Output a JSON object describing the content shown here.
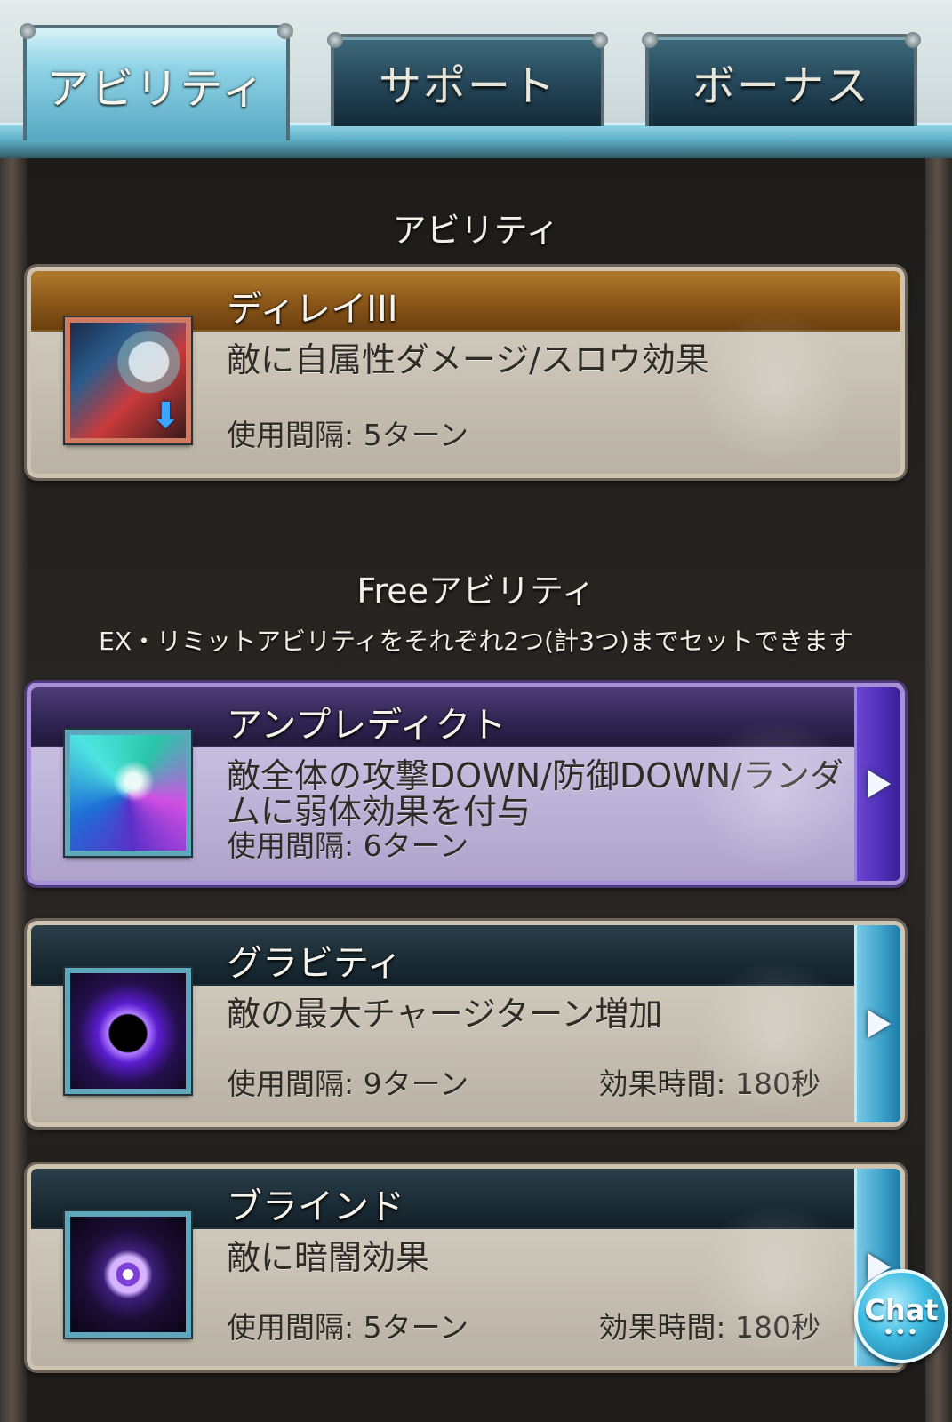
{
  "tabs": [
    {
      "label": "アビリティ",
      "active": true
    },
    {
      "label": "サポート",
      "active": false
    },
    {
      "label": "ボーナス",
      "active": false
    }
  ],
  "ability_section": {
    "title": "アビリティ",
    "items": [
      {
        "name": "ディレイIII",
        "description": "敵に自属性ダメージ/スロウ効果",
        "interval": "使用間隔: 5ターン",
        "icon": "delay-icon",
        "style": "orange"
      }
    ]
  },
  "free_section": {
    "title": "Freeアビリティ",
    "note": "EX・リミットアビリティをそれぞれ2つ(計3つ)までセットできます",
    "items": [
      {
        "name": "アンプレディクト",
        "description": "敵全体の攻撃DOWN/防御DOWN/ランダムに弱体効果を付与",
        "interval": "使用間隔: 6ターン",
        "icon": "unpredict-icon",
        "style": "purple"
      },
      {
        "name": "グラビティ",
        "description": "敵の最大チャージターン増加",
        "interval": "使用間隔: 9ターン",
        "duration": "効果時間: 180秒",
        "icon": "gravity-icon",
        "style": "blue"
      },
      {
        "name": "ブラインド",
        "description": "敵に暗闇効果",
        "interval": "使用間隔: 5ターン",
        "duration": "効果時間: 180秒",
        "icon": "blind-icon",
        "style": "blue"
      }
    ]
  },
  "chat": {
    "label": "Chat",
    "dots": "•••"
  },
  "colors": {
    "tab_active": "#8fd3e6",
    "tab_inactive": "#234456",
    "card_orange": "#8a5618",
    "card_purple": "#4d2db8",
    "card_blue": "#3aa0c9"
  }
}
